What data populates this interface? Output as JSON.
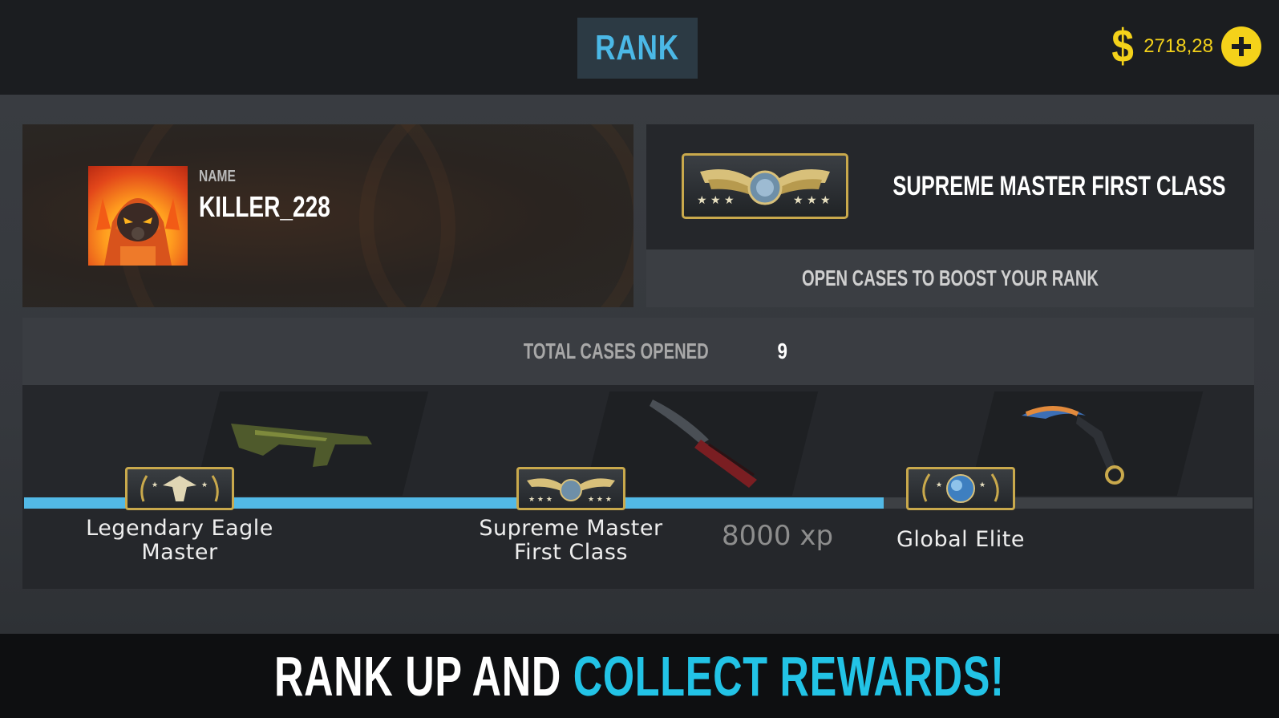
{
  "header": {
    "title": "RANK",
    "balance": "2718,28",
    "currency_icon": "dollar-icon",
    "add_button_icon": "plus-icon"
  },
  "profile": {
    "name_label": "NAME",
    "name": "KILLER_228",
    "avatar_icon": "hooded-fire-avatar"
  },
  "rank": {
    "current": "SUPREME MASTER FIRST CLASS",
    "hint": "OPEN CASES TO BOOST YOUR RANK",
    "badge_icon": "winged-globe-rank-icon"
  },
  "progress": {
    "total_label": "TOTAL CASES OPENED",
    "total_value": "9",
    "xp_label": "8000 xp",
    "filled_fraction": 0.7,
    "nodes": [
      {
        "title_line1": "Legendary Eagle",
        "title_line2": "Master",
        "icon": "eagle-rank-icon"
      },
      {
        "title_line1": "Supreme Master",
        "title_line2": "First Class",
        "icon": "winged-globe-rank-icon"
      },
      {
        "title_line1": "Global Elite",
        "title_line2": "",
        "icon": "globe-elite-rank-icon"
      }
    ],
    "rewards": [
      {
        "icon": "rifle-reward-icon"
      },
      {
        "icon": "butterfly-knife-reward-icon"
      },
      {
        "icon": "karambit-reward-icon"
      }
    ]
  },
  "banner": {
    "text_white": "RANK UP AND ",
    "text_cyan": "COLLECT REWARDS!"
  },
  "colors": {
    "accent": "#52b9e6",
    "gold": "#f4d21a",
    "banner_cyan": "#22c3e6"
  }
}
